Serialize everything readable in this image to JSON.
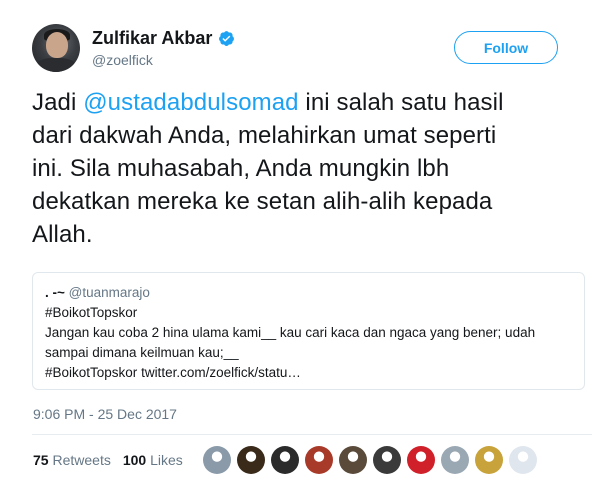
{
  "author": {
    "display_name": "Zulfikar Akbar",
    "handle": "@zoelfick",
    "verified": true
  },
  "follow_button": {
    "label": "Follow"
  },
  "tweet": {
    "lines": [
      {
        "pre": "Jadi ",
        "mention": "@ustadabdulsomad",
        "post": " ini salah satu hasil"
      },
      {
        "pre": "dari dakwah Anda, melahirkan umat seperti",
        "mention": "",
        "post": ""
      },
      {
        "pre": "ini. Sila muhasabah, Anda mungkin lbh",
        "mention": "",
        "post": ""
      },
      {
        "pre": "dekatkan mereka ke setan alih-alih kepada",
        "mention": "",
        "post": ""
      },
      {
        "pre": "Allah.",
        "mention": "",
        "post": ""
      }
    ]
  },
  "quoted_tweet": {
    "name": ". -~",
    "handle": "@tuanmarajo",
    "lines": [
      "#BoikotTopskor",
      "Jangan kau coba 2 hina ulama kami__ kau cari kaca dan ngaca yang bener; udah",
      "sampai dimana keilmuan kau;__"
    ],
    "last_line_text": "#BoikotTopskor ",
    "last_line_link": "twitter.com/zoelfick/statu…"
  },
  "timestamp": "9:06 PM - 25 Dec 2017",
  "stats": {
    "retweets_count": "75",
    "retweets_label": "Retweets",
    "likes_count": "100",
    "likes_label": "Likes"
  },
  "likers": [
    {
      "icon": "avatar-gray-person",
      "color": "#8a9aa8"
    },
    {
      "icon": "avatar-mask",
      "color": "#3a2a1a"
    },
    {
      "icon": "avatar-dark-person",
      "color": "#2b2b2b"
    },
    {
      "icon": "avatar-red-group",
      "color": "#a83a2a"
    },
    {
      "icon": "avatar-bearded-man",
      "color": "#5a4a3a"
    },
    {
      "icon": "avatar-dark-man",
      "color": "#3a3a3a"
    },
    {
      "icon": "avatar-red-white-flag",
      "color": "#d0202a"
    },
    {
      "icon": "avatar-default",
      "color": "#9aa8b4"
    },
    {
      "icon": "avatar-gold-emblem",
      "color": "#c8a23a"
    },
    {
      "icon": "avatar-white-figure",
      "color": "#dfe6ee"
    }
  ],
  "colors": {
    "accent": "#1da1f2",
    "text": "#14171a",
    "muted": "#657786",
    "border": "#e1e8ed"
  }
}
